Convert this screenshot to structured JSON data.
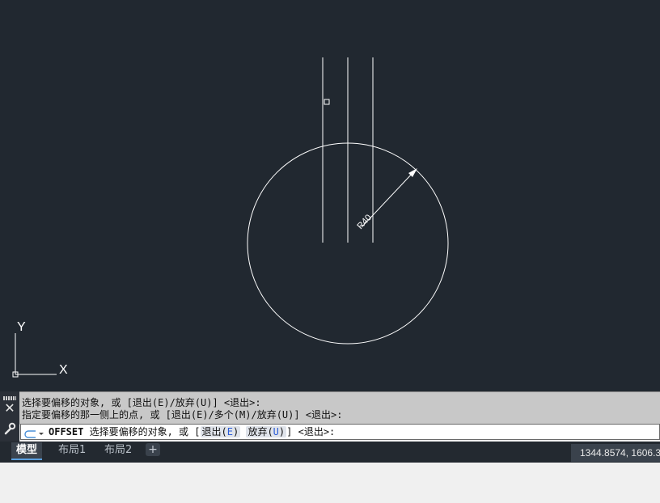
{
  "drawing": {
    "dimension_label": "R40",
    "ucs_y_label": "Y",
    "ucs_x_label": "X"
  },
  "command_history": {
    "line1": "选择要偏移的对象, 或 [退出(E)/放弃(U)] <退出>:",
    "line2": "指定要偏移的那一侧上的点, 或 [退出(E)/多个(M)/放弃(U)] <退出>:"
  },
  "command_line": {
    "command": "OFFSET",
    "prompt": "选择要偏移的对象, 或 [",
    "option1_text": "退出(",
    "option1_key": "E",
    "option1_end": ")",
    "option2_text": "放弃(",
    "option2_key": "U",
    "option2_end": ")",
    "suffix": "] <退出>:"
  },
  "tabs": {
    "model": "模型",
    "layout1": "布局1",
    "layout2": "布局2",
    "add": "+"
  },
  "status": {
    "coordinates": "1344.8574, 1606.3"
  },
  "icons": {
    "close": "close-icon",
    "wrench": "wrench-icon",
    "command_prompt": "command-prompt-icon"
  },
  "colors": {
    "canvas_bg": "#212830",
    "geometry": "#ffffff",
    "active_tab_accent": "#5aa0e0"
  }
}
